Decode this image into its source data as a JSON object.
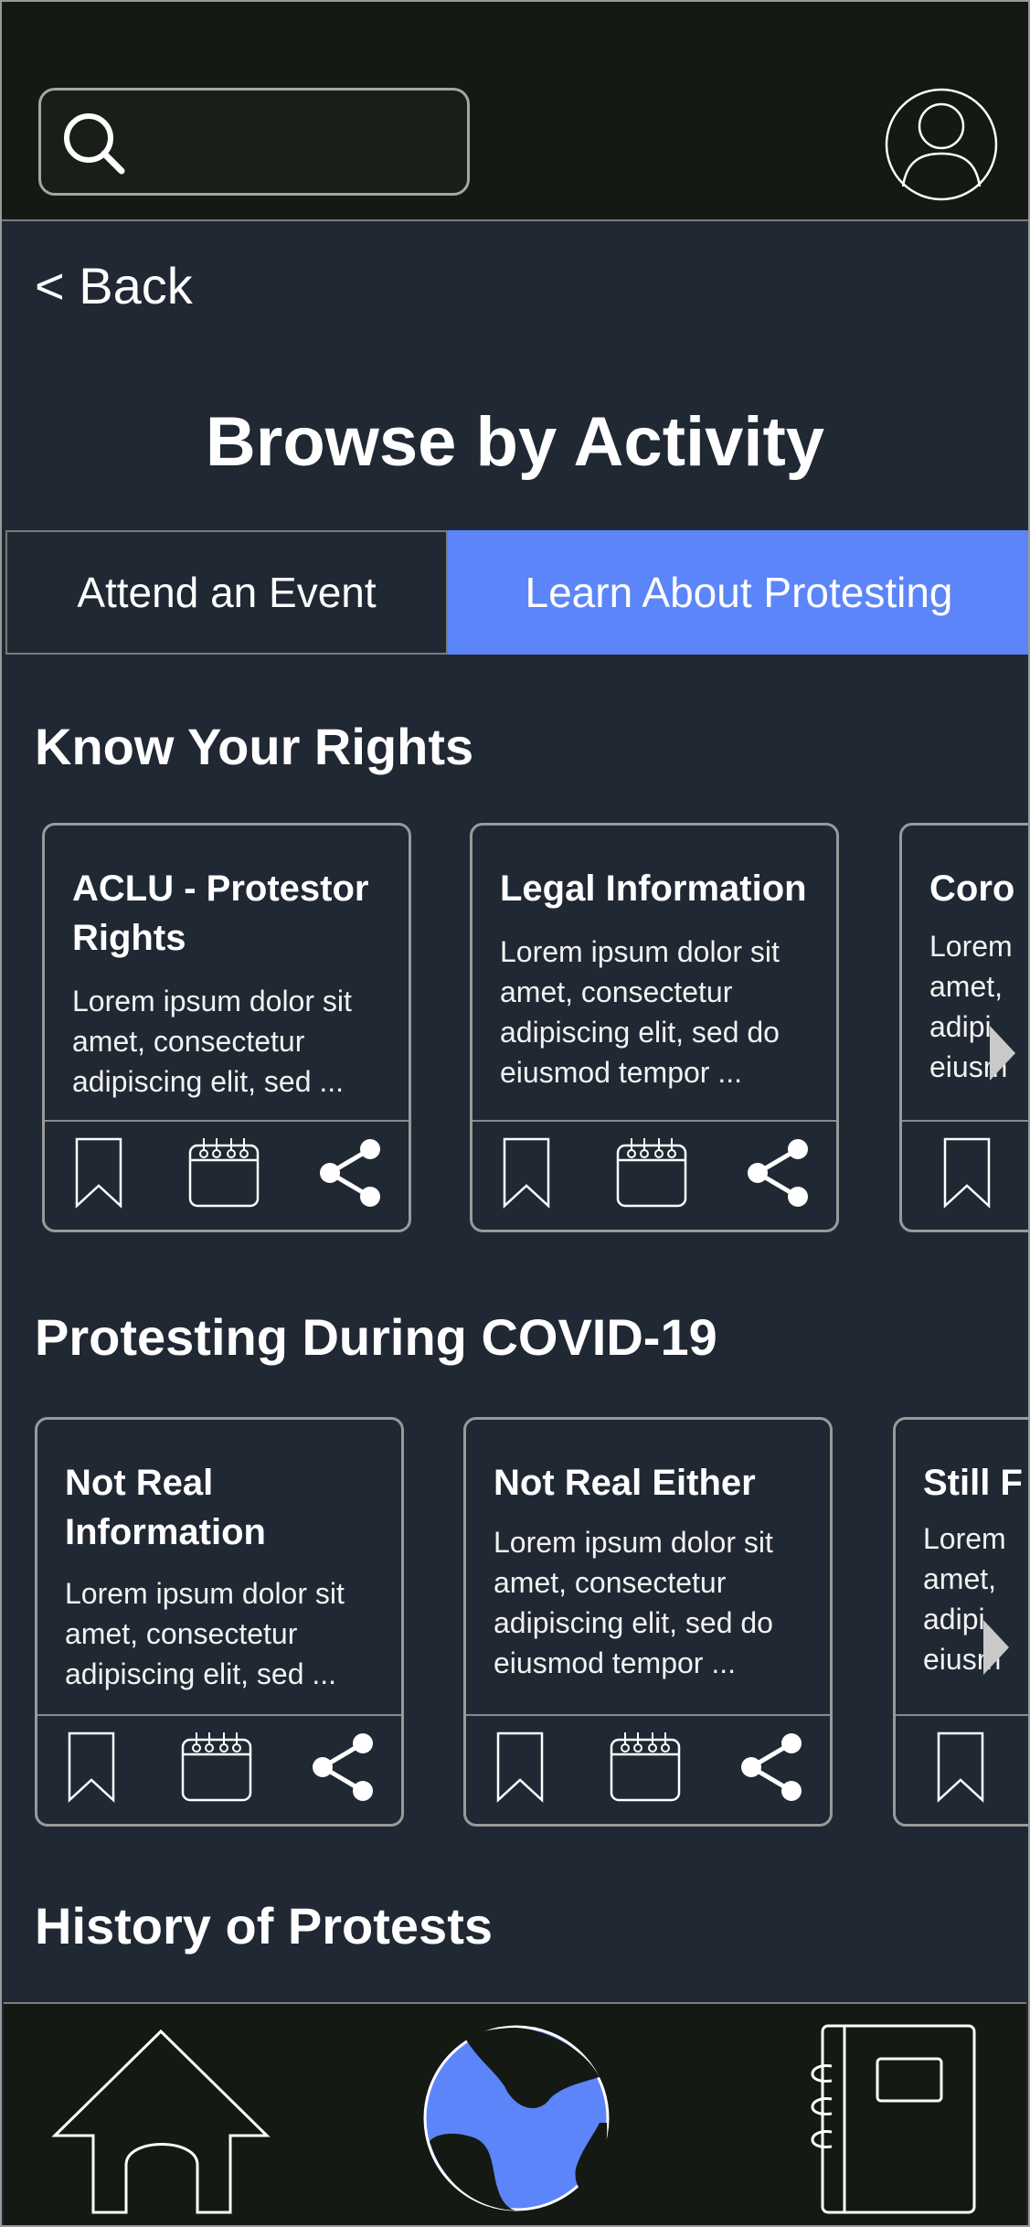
{
  "search": {
    "placeholder": "",
    "value": ""
  },
  "nav": {
    "back_label": "< Back"
  },
  "page": {
    "title": "Browse by Activity"
  },
  "tabs": [
    {
      "label": "Attend an Event",
      "active": false
    },
    {
      "label": "Learn About Protesting",
      "active": true
    }
  ],
  "sections": [
    {
      "heading": "Know Your Rights",
      "cards": [
        {
          "title": "ACLU - Protestor Rights",
          "body": "Lorem ipsum dolor sit amet, consectetur adipiscing elit, sed ..."
        },
        {
          "title": "Legal Information",
          "body": "Lorem ipsum dolor sit amet, consectetur adipiscing elit, sed do eiusmod tempor ..."
        },
        {
          "title": "Coro",
          "body": "Lorem amet, adipi eiusm"
        }
      ]
    },
    {
      "heading": "Protesting During COVID-19",
      "cards": [
        {
          "title": "Not Real Information",
          "body": "Lorem ipsum dolor sit amet, consectetur adipiscing elit, sed ..."
        },
        {
          "title": "Not Real Either",
          "body": "Lorem ipsum dolor sit amet, consectetur adipiscing elit, sed do eiusmod tempor ..."
        },
        {
          "title": "Still F",
          "body": "Lorem amet, adipi eiusm"
        }
      ]
    },
    {
      "heading": "History of Protests"
    }
  ],
  "icons": {
    "search": "search-icon",
    "profile": "profile-icon",
    "bookmark": "bookmark-icon",
    "calendar": "calendar-icon",
    "share": "share-icon",
    "next": "chevron-right-icon",
    "home": "home-icon",
    "globe": "globe-icon",
    "notebook": "notebook-icon"
  },
  "colors": {
    "background": "#202833",
    "topbar": "#151914",
    "accent": "#5c85f9",
    "border": "#9a9a9a",
    "text": "#ffffff"
  }
}
